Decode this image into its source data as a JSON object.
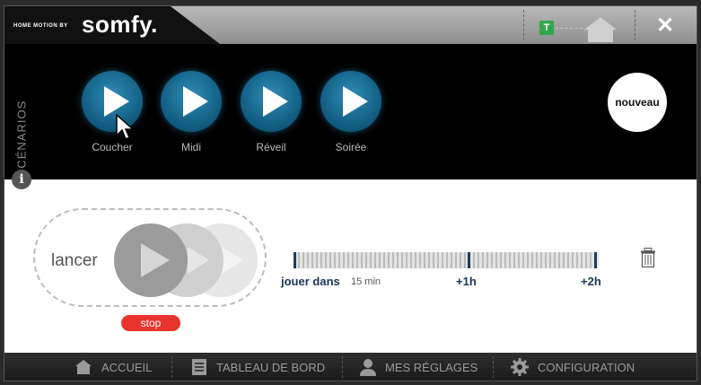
{
  "header": {
    "brand_small": "HOME MOTION BY",
    "brand_big": "somfy.",
    "t_badge": "T",
    "close_icon": "✕"
  },
  "scenarios": {
    "title": "SCÉNARIOS",
    "items": [
      {
        "label": "Coucher"
      },
      {
        "label": "Midi"
      },
      {
        "label": "Réveil"
      },
      {
        "label": "Soirée"
      }
    ],
    "new_label": "nouveau",
    "info_icon": "i"
  },
  "main": {
    "lancer_label": "lancer",
    "stop_label": "stop",
    "timeline": {
      "play_in_label": "jouer dans",
      "start_value": "15 min",
      "mark_1h": "+1h",
      "mark_2h": "+2h"
    }
  },
  "nav": {
    "items": [
      {
        "label": "ACCUEIL",
        "icon": "home-icon"
      },
      {
        "label": "TABLEAU DE BORD",
        "icon": "document-icon"
      },
      {
        "label": "MES RÉGLAGES",
        "icon": "user-icon"
      },
      {
        "label": "CONFIGURATION",
        "icon": "gear-icon"
      }
    ]
  },
  "colors": {
    "accent_blue": "#1b6e96",
    "stop_red": "#e8342c",
    "badge_green": "#2fa84a",
    "timeline_navy": "#1b3555"
  }
}
